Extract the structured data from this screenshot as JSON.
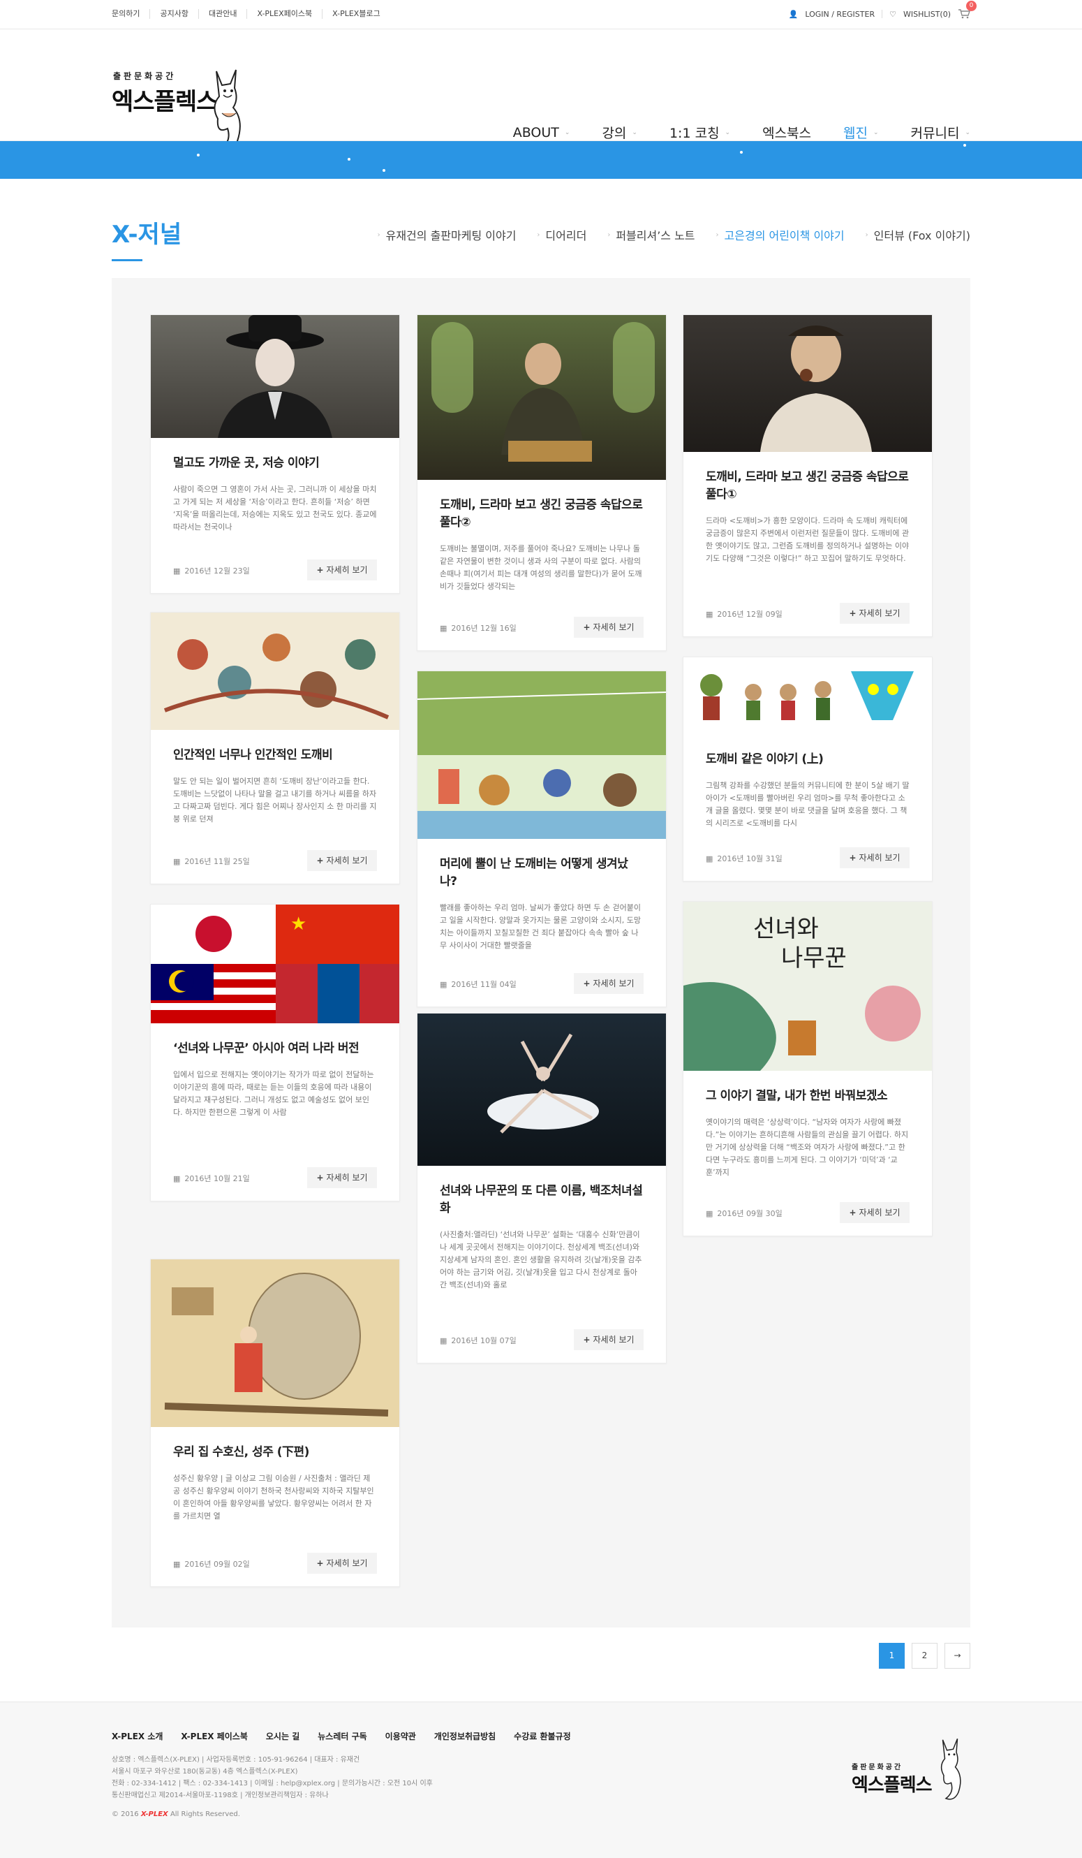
{
  "topbar": {
    "links": [
      "문의하기",
      "공지사항",
      "대관안내",
      "X-PLEX페이스북",
      "X-PLEX블로그"
    ],
    "login": "LOGIN / REGISTER",
    "wishlist": "WISHLIST(0)",
    "cart_count": "0"
  },
  "logo": {
    "tag": "출판문화공간",
    "name": "엑스플렉스"
  },
  "gnb": [
    {
      "label": "ABOUT"
    },
    {
      "label": "강의"
    },
    {
      "label": "1:1 코칭"
    },
    {
      "label": "엑스북스"
    },
    {
      "label": "웹진"
    },
    {
      "label": "커뮤니티"
    }
  ],
  "page": {
    "title": "X-저널"
  },
  "snb": [
    {
      "label": "유재건의 출판마케팅 이야기"
    },
    {
      "label": "디어리더"
    },
    {
      "label": "퍼블리셔’스 노트"
    },
    {
      "label": "고은경의 어린이책 이야기"
    },
    {
      "label": "인터뷰 (Fox 이야기)"
    }
  ],
  "more_label": "자세히 보기",
  "posts": [
    {
      "title": "멀고도 가까운 곳, 저승 이야기",
      "excerpt": "사람이 죽으면 그 영혼이 가서 사는 곳, 그러니까 이 세상을 마치고 가게 되는 저 세상을 ‘저승’이라고 한다. 흔히들 ‘저승’ 하면 ‘지옥’을 떠올리는데, 저승에는 지옥도 있고 천국도 있다. 종교에 따라서는 천국이나",
      "date": "2016년 12월 23일"
    },
    {
      "title": "도깨비, 드라마 보고 생긴 궁금증 속답으로 풀다②",
      "excerpt": "도깨비는 불멸이며, 저주를 풀어야 죽나요? 도깨비는 나무나 돌 같은 자연물이 변한 것이니 생과 사의 구분이 따로 없다. 사람의 손때나 피(여기서 피는 대개 여성의 생리를 말한다)가 묻어 도깨비가 깃들었다 생각되는",
      "date": "2016년 12월 16일"
    },
    {
      "title": "도깨비, 드라마 보고 생긴 궁금증 속답으로 풀다①",
      "excerpt": "드라마 <도깨비>가 흥한 모양이다. 드라마 속 도깨비 캐릭터에 궁금증이 많은지 주변에서 이런저런 질문들이 많다. 도깨비에 관한 옛이야기도 많고, 그런즘 도깨비를 정의하거나 설명하는 이야기도 다양해 “그것은 이렇다!” 하고 꼬집어 말하기도 무엇하다.",
      "date": "2016년 12월 09일"
    },
    {
      "title": "인간적인 너무나 인간적인 도깨비",
      "excerpt": "말도 안 되는 일이 벌어지면 흔히 ‘도깨비 장난’이라고들 한다. 도깨비는 느닷없이 나타나 말을 걸고 내기를 하거나 씨름을 하자고 다짜고짜 덤빈다. 게다 힘은 어찌나 장사인지 소 한 마리를 지붕 위로 던져",
      "date": "2016년 11월 25일"
    },
    {
      "title": "머리에 뿔이 난 도깨비는 어떻게 생겨났나?",
      "excerpt": "빨래를 좋아하는 우리 엄마. 날씨가 좋았다 하면 두 손 걷어붙이고 일을 시작한다. 양말과 옷가지는 물론 고양이와 소시지, 도망치는 아이들까지 꼬칠꼬칠한 건 죄다 붙잡아다 속속 빨아 숲 나무 사이사이 거대한 빨랫줄을",
      "date": "2016년 11월 04일"
    },
    {
      "title": "도깨비 같은 이야기 (上)",
      "excerpt": "그림책 강좌를 수강했던 분들의 커뮤니티에 한 분이 5살 배기 딸아이가 <도깨비를 빨아버린 우리 엄마>를 무척 좋아한다고 소개 글을 올렸다. 몇몇 분이 바로 댓글을 달며 호응을 했다. 그 책의 시리즈로 <도깨비를 다시",
      "date": "2016년 10월 31일"
    },
    {
      "title": "‘선녀와 나무꾼’ 아시아 여러 나라 버전",
      "excerpt": "입에서 입으로 전해지는 옛이야기는 작가가 따로 없이 전달하는 이야기꾼의 흥에 따라, 때로는 듣는 이들의 호응에 따라 내용이 달라지고 재구성된다. 그러니 개성도 없고 예술성도 없어 보인다. 하지만 한편으론 그렇게 이 사람",
      "date": "2016년 10월 21일"
    },
    {
      "title": "그 이야기 결말, 내가 한번 바꿔보겠소",
      "excerpt": "옛이야기의 매력은 ‘상상력’이다. “남자와 여자가 사랑에 빠졌다.”는 이야기는 흔하디흔해 사람들의 관심을 끌기 어렵다. 하지만 거기에 상상력을 더해 “백조와 여자가 사랑에 빠졌다.”고 한다면 누구라도 흥미를 느끼게 된다. 그 이야기가 ‘미덕’과 ‘교훈’까지",
      "date": "2016년 09월 30일"
    },
    {
      "title": "선녀와 나무꾼의 또 다른 이름, 백조처녀설화",
      "excerpt": "(사진출처:앨라딘) ‘선녀와 나무꾼’ 설화는 ‘대홍수 신화’만큼이나 세계 곳곳에서 전해지는 이야기이다. 천상세계 백조(선녀)와 지상세계 남자의 혼인. 혼인 생활을 유지하려 깃(날개)옷을 감추어야 하는 금기와 어김, 깃(날개)옷을 입고 다시 천상계로 돌아간 백조(선녀)와 홀로",
      "date": "2016년 10월 07일"
    },
    {
      "title": "우리 집 수호신, 성주 (下편)",
      "excerpt": "성주신 황우양 | 글 이상교 그림 이승원 / 사진출처 : 앨라딘 제공 성주신 황우양씨 이야기 천하국 천사랑씨와 지하국 지탈부인이 혼인하여 아들 황우양씨를 낳았다. 황우양씨는 어려서 한 자를 가르치면 열",
      "date": "2016년 09월 02일"
    }
  ],
  "pager": {
    "pages": [
      "1",
      "2"
    ],
    "next": "→"
  },
  "footer": {
    "nav": [
      "X-PLEX 소개",
      "X-PLEX 페이스북",
      "오시는 길",
      "뉴스레터 구독",
      "이용약관",
      "개인정보취급방침",
      "수강료 환불규정"
    ],
    "info": [
      "상호명 : 엑스플렉스(X-PLEX) | 사업자등록번호 : 105-91-96264 | 대표자 : 유재건",
      "서울시 마포구 와우산로 180(동교동) 4층 엑스플렉스(X-PLEX)",
      "전화 : 02-334-1412 | 팩스 : 02-334-1413 | 이메일 : help@xplex.org | 문의가능시간 : 오전 10시 이후",
      "통신판매업신고 제2014-서울마포-1198호 | 개인정보관리책임자 : 유하나"
    ],
    "copy_prefix": "© 2016",
    "copy_brand": "X-PLEX",
    "copy_suffix": "All Rights Reserved."
  }
}
